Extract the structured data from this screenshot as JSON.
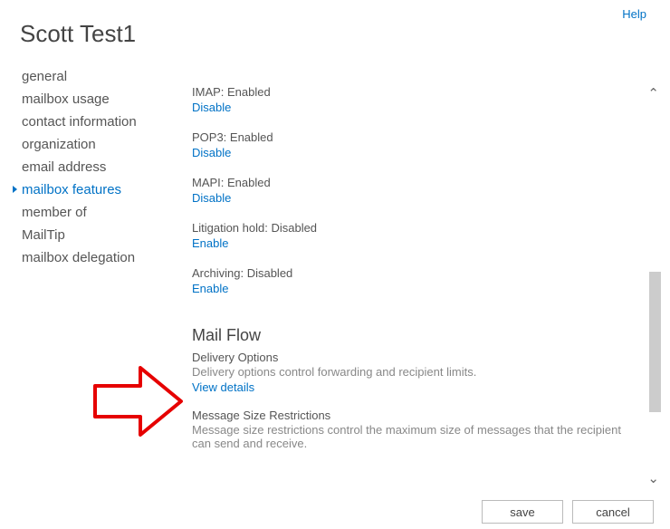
{
  "help_label": "Help",
  "title": "Scott Test1",
  "sidebar": {
    "items": [
      {
        "label": "general"
      },
      {
        "label": "mailbox usage"
      },
      {
        "label": "contact information"
      },
      {
        "label": "organization"
      },
      {
        "label": "email address"
      },
      {
        "label": "mailbox features"
      },
      {
        "label": "member of"
      },
      {
        "label": "MailTip"
      },
      {
        "label": "mailbox delegation"
      }
    ],
    "selected_index": 5
  },
  "main": {
    "features": [
      {
        "label": "IMAP: Enabled",
        "action": "Disable"
      },
      {
        "label": "POP3: Enabled",
        "action": "Disable"
      },
      {
        "label": "MAPI: Enabled",
        "action": "Disable"
      },
      {
        "label": "Litigation hold: Disabled",
        "action": "Enable"
      },
      {
        "label": "Archiving: Disabled",
        "action": "Enable"
      }
    ],
    "section_heading": "Mail Flow",
    "delivery": {
      "title": "Delivery Options",
      "desc": "Delivery options control forwarding and recipient limits.",
      "link": "View details"
    },
    "msg_size": {
      "title": "Message Size Restrictions",
      "desc": "Message size restrictions control the maximum size of messages that the recipient can send and receive."
    }
  },
  "buttons": {
    "save": "save",
    "cancel": "cancel"
  },
  "icons": {
    "scroll_up": "⌃",
    "scroll_down": "⌄"
  }
}
